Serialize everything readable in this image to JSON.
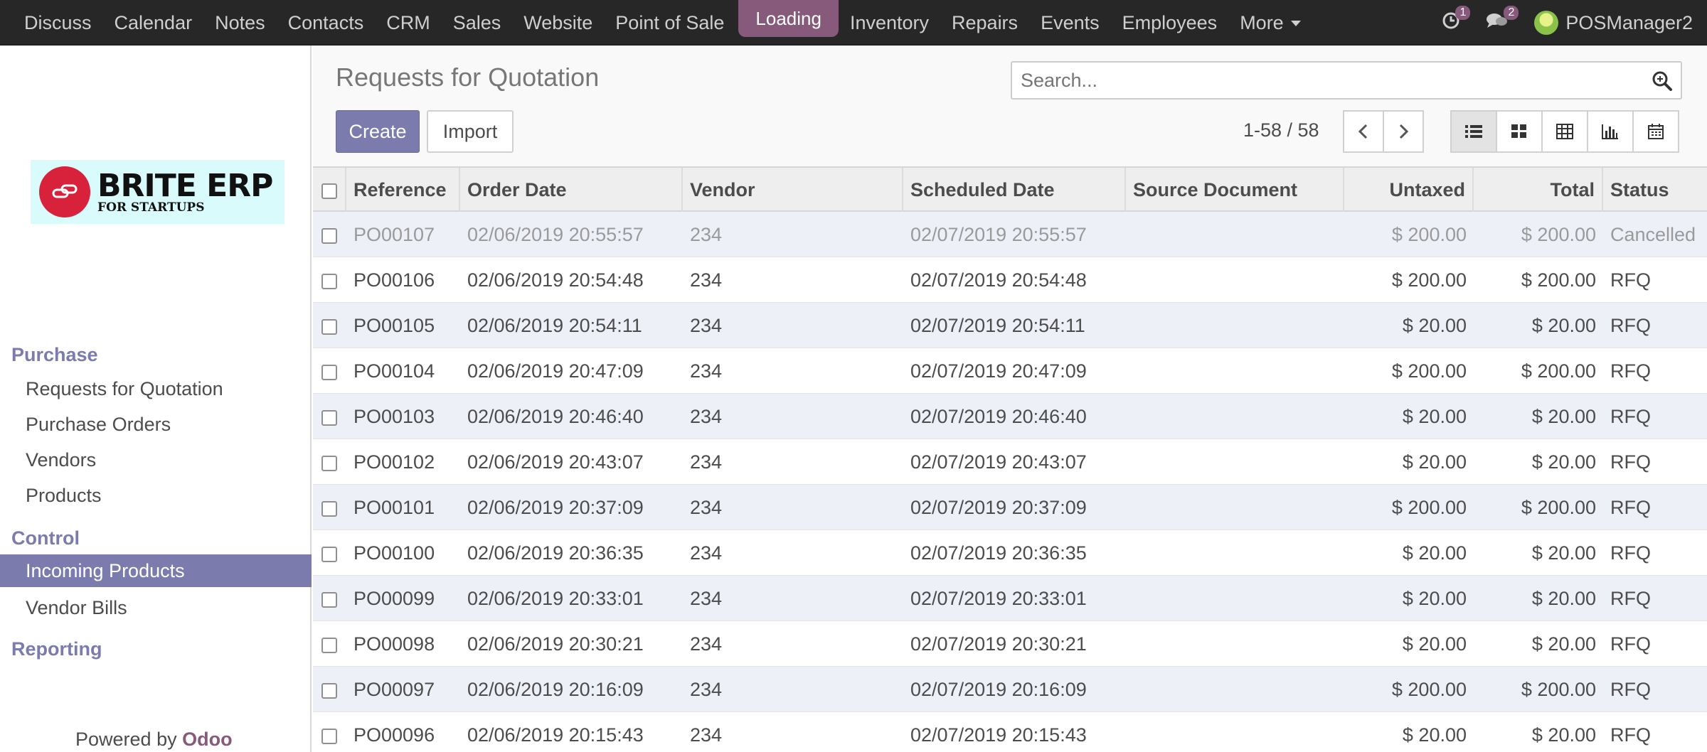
{
  "topbar": {
    "menu": [
      "Discuss",
      "Calendar",
      "Notes",
      "Contacts",
      "CRM",
      "Sales",
      "Website",
      "Point of Sale"
    ],
    "loading": "Loading",
    "menu2": [
      "Inventory",
      "Repairs",
      "Events",
      "Employees"
    ],
    "more": "More",
    "activity_count": "1",
    "message_count": "2",
    "user": "POSManager2"
  },
  "sidebar": {
    "logo_main": "BRITE ERP",
    "logo_sub": "FOR STARTUPS",
    "sections": [
      {
        "label": "Purchase",
        "items": [
          "Requests for Quotation",
          "Purchase Orders",
          "Vendors",
          "Products"
        ]
      },
      {
        "label": "Control",
        "items": [
          "Incoming Products",
          "Vendor Bills"
        ]
      },
      {
        "label": "Reporting",
        "items": []
      }
    ],
    "powered_by": "Powered by",
    "odoo": "Odoo"
  },
  "control_panel": {
    "title": "Requests for Quotation",
    "search_placeholder": "Search...",
    "create": "Create",
    "import": "Import",
    "pager": "1-58 / 58"
  },
  "table": {
    "headers": [
      "Reference",
      "Order Date",
      "Vendor",
      "Scheduled Date",
      "Source Document",
      "Untaxed",
      "Total",
      "Status"
    ],
    "rows": [
      [
        "PO00107",
        "02/06/2019 20:55:57",
        "234",
        "02/07/2019 20:55:57",
        "",
        "$ 200.00",
        "$ 200.00",
        "Cancelled"
      ],
      [
        "PO00106",
        "02/06/2019 20:54:48",
        "234",
        "02/07/2019 20:54:48",
        "",
        "$ 200.00",
        "$ 200.00",
        "RFQ"
      ],
      [
        "PO00105",
        "02/06/2019 20:54:11",
        "234",
        "02/07/2019 20:54:11",
        "",
        "$ 20.00",
        "$ 20.00",
        "RFQ"
      ],
      [
        "PO00104",
        "02/06/2019 20:47:09",
        "234",
        "02/07/2019 20:47:09",
        "",
        "$ 200.00",
        "$ 200.00",
        "RFQ"
      ],
      [
        "PO00103",
        "02/06/2019 20:46:40",
        "234",
        "02/07/2019 20:46:40",
        "",
        "$ 20.00",
        "$ 20.00",
        "RFQ"
      ],
      [
        "PO00102",
        "02/06/2019 20:43:07",
        "234",
        "02/07/2019 20:43:07",
        "",
        "$ 20.00",
        "$ 20.00",
        "RFQ"
      ],
      [
        "PO00101",
        "02/06/2019 20:37:09",
        "234",
        "02/07/2019 20:37:09",
        "",
        "$ 200.00",
        "$ 200.00",
        "RFQ"
      ],
      [
        "PO00100",
        "02/06/2019 20:36:35",
        "234",
        "02/07/2019 20:36:35",
        "",
        "$ 20.00",
        "$ 20.00",
        "RFQ"
      ],
      [
        "PO00099",
        "02/06/2019 20:33:01",
        "234",
        "02/07/2019 20:33:01",
        "",
        "$ 20.00",
        "$ 20.00",
        "RFQ"
      ],
      [
        "PO00098",
        "02/06/2019 20:30:21",
        "234",
        "02/07/2019 20:30:21",
        "",
        "$ 20.00",
        "$ 20.00",
        "RFQ"
      ],
      [
        "PO00097",
        "02/06/2019 20:16:09",
        "234",
        "02/07/2019 20:16:09",
        "",
        "$ 200.00",
        "$ 200.00",
        "RFQ"
      ],
      [
        "PO00096",
        "02/06/2019 20:15:43",
        "234",
        "02/07/2019 20:15:43",
        "",
        "$ 20.00",
        "$ 20.00",
        "RFQ"
      ]
    ]
  },
  "colors": {
    "topbar": "#272727",
    "accent": "#7c7bad",
    "odoo": "#875a7b",
    "row_alt": "#eef0f8"
  }
}
